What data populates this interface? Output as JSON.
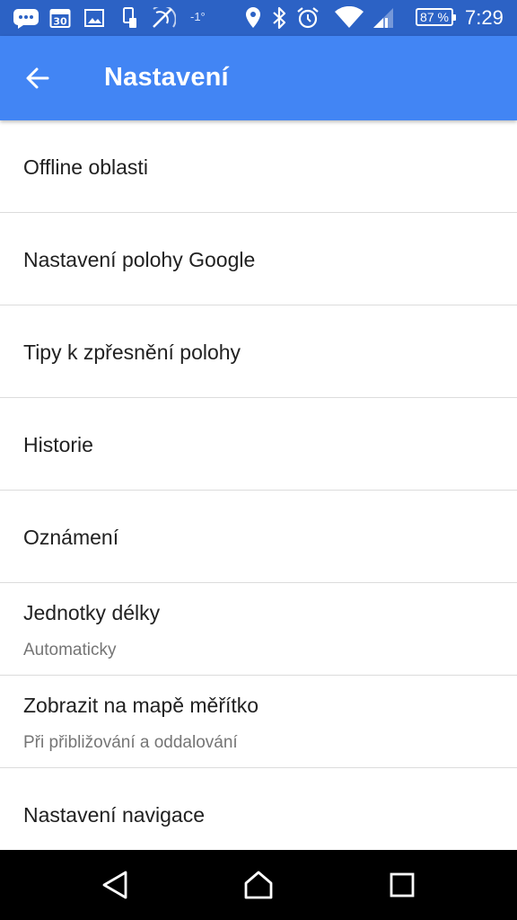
{
  "status_bar": {
    "temperature": "-1°",
    "calendar_day": "30",
    "battery": "87 %",
    "time": "7:29"
  },
  "app_bar": {
    "title": "Nastavení"
  },
  "settings": [
    {
      "title": "Offline oblasti"
    },
    {
      "title": "Nastavení polohy Google"
    },
    {
      "title": "Tipy k zpřesnění polohy"
    },
    {
      "title": "Historie"
    },
    {
      "title": "Oznámení"
    },
    {
      "title": "Jednotky délky",
      "subtitle": "Automaticky"
    },
    {
      "title": "Zobrazit na mapě měřítko",
      "subtitle": "Při přibližování a oddalování"
    },
    {
      "title": "Nastavení navigace"
    }
  ],
  "colors": {
    "status_bar": "#2c62c5",
    "app_bar": "#4285f4",
    "nav_bar": "#000000"
  },
  "icons": {
    "status": [
      "messenger-icon",
      "calendar-icon",
      "gallery-icon",
      "device-icon",
      "nfc-icon",
      "location-icon",
      "bluetooth-icon",
      "alarm-icon",
      "wifi-icon",
      "signal-icon",
      "battery-icon"
    ],
    "navigation": [
      "back-triangle-icon",
      "home-icon",
      "recents-icon"
    ]
  }
}
